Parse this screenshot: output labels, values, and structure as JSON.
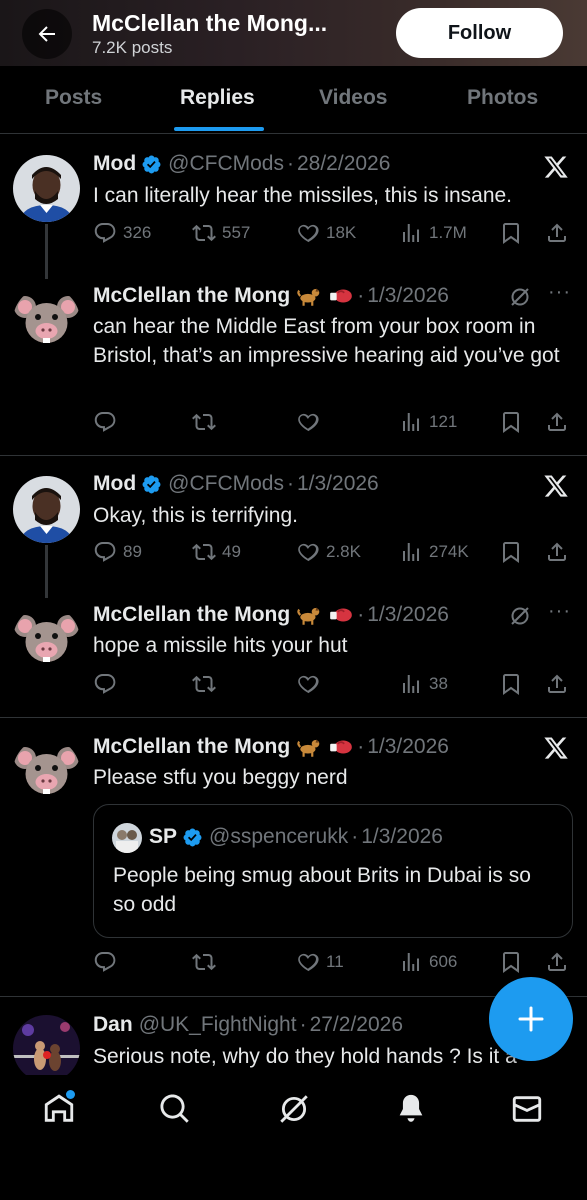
{
  "header": {
    "title": "McClellan the Mong...",
    "posts_count": "7.2K posts",
    "follow_label": "Follow"
  },
  "tabs": [
    "Posts",
    "Replies",
    "Videos",
    "Photos"
  ],
  "active_tab": "Replies",
  "tweets": [
    {
      "name": "Mod",
      "handle": "@CFCMods",
      "date": "28/2/2026",
      "text": "I can literally hear the missiles, this is insane.",
      "replies": "326",
      "reposts": "557",
      "likes": "18K",
      "views": "1.7M"
    },
    {
      "name": "McClellan the Mong",
      "date": "1/3/2026",
      "text": "can hear the Middle East from your box room in Bristol, that’s an impressive hearing aid you’ve got",
      "replies": "",
      "reposts": "",
      "likes": "",
      "views": "121"
    },
    {
      "name": "Mod",
      "handle": "@CFCMods",
      "date": "1/3/2026",
      "text": "Okay, this is terrifying.",
      "replies": "89",
      "reposts": "49",
      "likes": "2.8K",
      "views": "274K"
    },
    {
      "name": "McClellan the Mong",
      "date": "1/3/2026",
      "text": "hope a missile hits your hut",
      "replies": "",
      "reposts": "",
      "likes": "",
      "views": "38"
    },
    {
      "name": "McClellan the Mong",
      "date": "1/3/2026",
      "text": "Please stfu you beggy nerd",
      "replies": "",
      "reposts": "",
      "likes": "11",
      "views": "606",
      "quote": {
        "name": "SP",
        "handle": "@sspencerukk",
        "date": "1/3/2026",
        "text": "People being smug about Brits in Dubai is so so odd"
      }
    },
    {
      "name": "Dan",
      "handle": "@UK_FightNight",
      "date": "27/2/2026",
      "text": "Serious note, why do they hold hands ? Is it a"
    }
  ],
  "colors": {
    "accent": "#1d9bf0",
    "muted": "#71767b",
    "background": "#000000"
  },
  "icons": [
    "back-arrow-icon",
    "verified-badge-icon",
    "x-logo-icon",
    "reply-icon",
    "repost-icon",
    "like-icon",
    "views-icon",
    "bookmark-icon",
    "share-icon",
    "grok-icon",
    "more-icon",
    "home-icon",
    "search-icon",
    "grok-nav-icon",
    "bell-icon",
    "mail-icon",
    "plus-icon"
  ]
}
